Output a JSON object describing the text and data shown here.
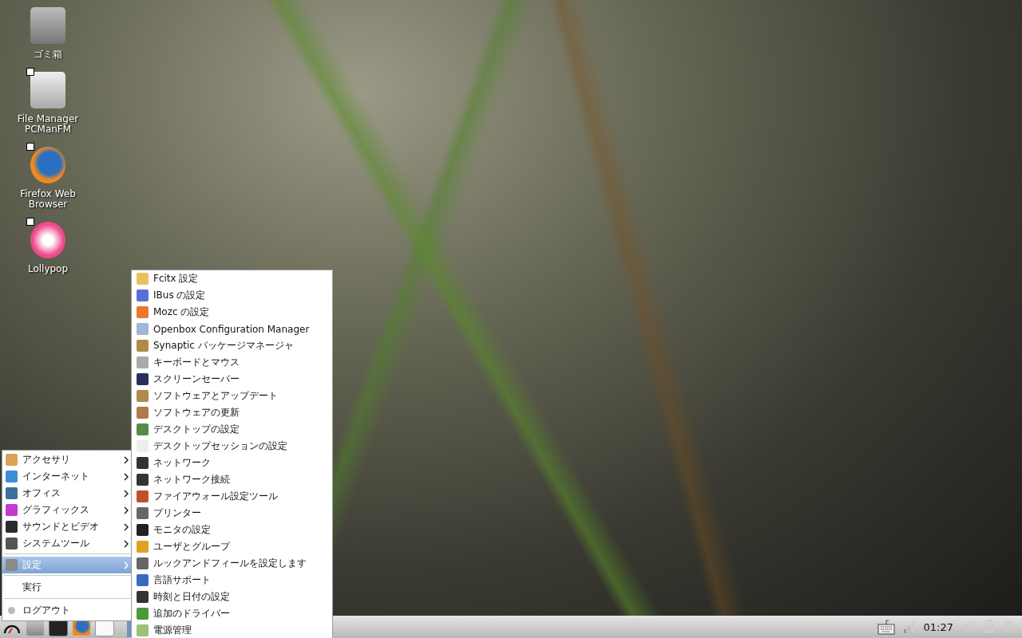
{
  "desktop_icons": [
    {
      "label": "ゴミ箱",
      "kind": "trash",
      "shortcut": false
    },
    {
      "label": "File Manager PCManFM",
      "kind": "files",
      "shortcut": true
    },
    {
      "label": "Firefox Web Browser",
      "kind": "browser",
      "shortcut": true
    },
    {
      "label": "Lollypop",
      "kind": "music",
      "shortcut": true
    }
  ],
  "main_menu": {
    "items": [
      {
        "kind": "category",
        "label": "アクセサリ",
        "selected": false
      },
      {
        "kind": "category",
        "label": "インターネット",
        "selected": false
      },
      {
        "kind": "category",
        "label": "オフィス",
        "selected": false
      },
      {
        "kind": "category",
        "label": "グラフィックス",
        "selected": false
      },
      {
        "kind": "category",
        "label": "サウンドとビデオ",
        "selected": false
      },
      {
        "kind": "category",
        "label": "システムツール",
        "selected": false
      },
      {
        "kind": "separator"
      },
      {
        "kind": "category",
        "label": "設定",
        "selected": true
      },
      {
        "kind": "separator"
      },
      {
        "kind": "action",
        "label": "実行",
        "selected": false
      },
      {
        "kind": "separator"
      },
      {
        "kind": "action",
        "label": "ログアウト",
        "selected": false
      }
    ]
  },
  "submenu": {
    "items": [
      "Fcitx 設定",
      "IBus の設定",
      "Mozc の設定",
      "Openbox Configuration Manager",
      "Synaptic パッケージマネージャ",
      "キーボードとマウス",
      "スクリーンセーバー",
      "ソフトウェアとアップデート",
      "ソフトウェアの更新",
      "デスクトップの設定",
      "デスクトップセッションの設定",
      "ネットワーク",
      "ネットワーク接続",
      "ファイアウォール設定ツール",
      "プリンター",
      "モニタの設定",
      "ユーザとグループ",
      "ルックアンドフィールを設定します",
      "言語サポート",
      "時刻と日付の設定",
      "追加のドライバー",
      "電源管理"
    ]
  },
  "taskbar": {
    "clock": "01:27"
  }
}
